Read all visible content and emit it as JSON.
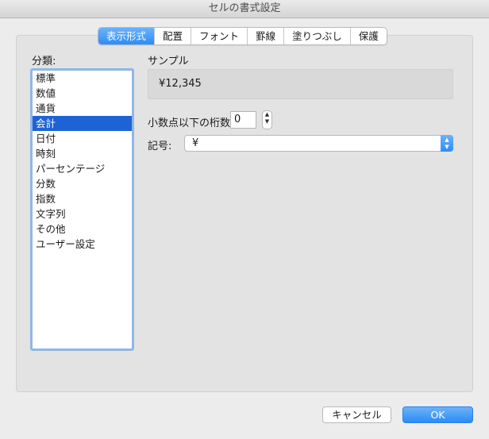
{
  "window": {
    "title": "セルの書式設定"
  },
  "tabs": [
    {
      "label": "表示形式",
      "active": true
    },
    {
      "label": "配置",
      "active": false
    },
    {
      "label": "フォント",
      "active": false
    },
    {
      "label": "罫線",
      "active": false
    },
    {
      "label": "塗りつぶし",
      "active": false
    },
    {
      "label": "保護",
      "active": false
    }
  ],
  "category": {
    "label": "分類:",
    "items": [
      "標準",
      "数値",
      "通貨",
      "会計",
      "日付",
      "時刻",
      "パーセンテージ",
      "分数",
      "指数",
      "文字列",
      "その他",
      "ユーザー設定"
    ],
    "selected": "会計"
  },
  "sample": {
    "label": "サンプル",
    "value": "¥12,345"
  },
  "decimal": {
    "label": "小数点以下の桁数:",
    "value": "0"
  },
  "symbol": {
    "label": "記号:",
    "value": "¥"
  },
  "buttons": {
    "cancel": "キャンセル",
    "ok": "OK"
  },
  "colors": {
    "accent": "#2c8cf6",
    "selection": "#1e63d6"
  }
}
